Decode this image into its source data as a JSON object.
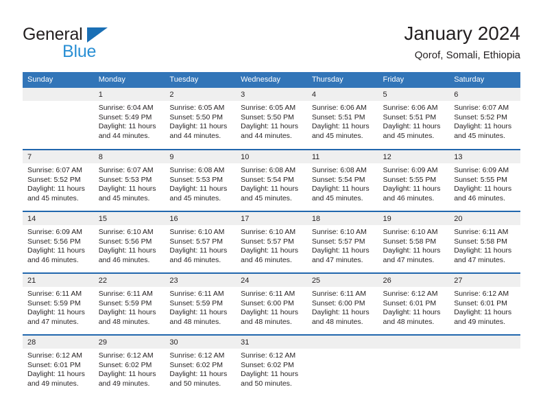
{
  "logo": {
    "primary_text": "General",
    "secondary_text": "Blue",
    "primary_color": "#231f20",
    "secondary_color": "#2a8fd4",
    "triangle_color": "#1a6fb5",
    "icon": "general-blue-logo"
  },
  "header": {
    "title": "January 2024",
    "subtitle": "Qorof, Somali, Ethiopia"
  },
  "theme": {
    "header_bg": "#3275b8",
    "header_text": "#ffffff",
    "row_separator": "#2066ad",
    "daynum_bg": "#efefef",
    "body_text": "#231f20"
  },
  "calendar": {
    "columns": [
      "Sunday",
      "Monday",
      "Tuesday",
      "Wednesday",
      "Thursday",
      "Friday",
      "Saturday"
    ],
    "weeks": [
      [
        {
          "day": "",
          "sunrise": "",
          "sunset": "",
          "daylight_line1": "",
          "daylight_line2": ""
        },
        {
          "day": "1",
          "sunrise": "Sunrise: 6:04 AM",
          "sunset": "Sunset: 5:49 PM",
          "daylight_line1": "Daylight: 11 hours",
          "daylight_line2": "and 44 minutes."
        },
        {
          "day": "2",
          "sunrise": "Sunrise: 6:05 AM",
          "sunset": "Sunset: 5:50 PM",
          "daylight_line1": "Daylight: 11 hours",
          "daylight_line2": "and 44 minutes."
        },
        {
          "day": "3",
          "sunrise": "Sunrise: 6:05 AM",
          "sunset": "Sunset: 5:50 PM",
          "daylight_line1": "Daylight: 11 hours",
          "daylight_line2": "and 44 minutes."
        },
        {
          "day": "4",
          "sunrise": "Sunrise: 6:06 AM",
          "sunset": "Sunset: 5:51 PM",
          "daylight_line1": "Daylight: 11 hours",
          "daylight_line2": "and 45 minutes."
        },
        {
          "day": "5",
          "sunrise": "Sunrise: 6:06 AM",
          "sunset": "Sunset: 5:51 PM",
          "daylight_line1": "Daylight: 11 hours",
          "daylight_line2": "and 45 minutes."
        },
        {
          "day": "6",
          "sunrise": "Sunrise: 6:07 AM",
          "sunset": "Sunset: 5:52 PM",
          "daylight_line1": "Daylight: 11 hours",
          "daylight_line2": "and 45 minutes."
        }
      ],
      [
        {
          "day": "7",
          "sunrise": "Sunrise: 6:07 AM",
          "sunset": "Sunset: 5:52 PM",
          "daylight_line1": "Daylight: 11 hours",
          "daylight_line2": "and 45 minutes."
        },
        {
          "day": "8",
          "sunrise": "Sunrise: 6:07 AM",
          "sunset": "Sunset: 5:53 PM",
          "daylight_line1": "Daylight: 11 hours",
          "daylight_line2": "and 45 minutes."
        },
        {
          "day": "9",
          "sunrise": "Sunrise: 6:08 AM",
          "sunset": "Sunset: 5:53 PM",
          "daylight_line1": "Daylight: 11 hours",
          "daylight_line2": "and 45 minutes."
        },
        {
          "day": "10",
          "sunrise": "Sunrise: 6:08 AM",
          "sunset": "Sunset: 5:54 PM",
          "daylight_line1": "Daylight: 11 hours",
          "daylight_line2": "and 45 minutes."
        },
        {
          "day": "11",
          "sunrise": "Sunrise: 6:08 AM",
          "sunset": "Sunset: 5:54 PM",
          "daylight_line1": "Daylight: 11 hours",
          "daylight_line2": "and 45 minutes."
        },
        {
          "day": "12",
          "sunrise": "Sunrise: 6:09 AM",
          "sunset": "Sunset: 5:55 PM",
          "daylight_line1": "Daylight: 11 hours",
          "daylight_line2": "and 46 minutes."
        },
        {
          "day": "13",
          "sunrise": "Sunrise: 6:09 AM",
          "sunset": "Sunset: 5:55 PM",
          "daylight_line1": "Daylight: 11 hours",
          "daylight_line2": "and 46 minutes."
        }
      ],
      [
        {
          "day": "14",
          "sunrise": "Sunrise: 6:09 AM",
          "sunset": "Sunset: 5:56 PM",
          "daylight_line1": "Daylight: 11 hours",
          "daylight_line2": "and 46 minutes."
        },
        {
          "day": "15",
          "sunrise": "Sunrise: 6:10 AM",
          "sunset": "Sunset: 5:56 PM",
          "daylight_line1": "Daylight: 11 hours",
          "daylight_line2": "and 46 minutes."
        },
        {
          "day": "16",
          "sunrise": "Sunrise: 6:10 AM",
          "sunset": "Sunset: 5:57 PM",
          "daylight_line1": "Daylight: 11 hours",
          "daylight_line2": "and 46 minutes."
        },
        {
          "day": "17",
          "sunrise": "Sunrise: 6:10 AM",
          "sunset": "Sunset: 5:57 PM",
          "daylight_line1": "Daylight: 11 hours",
          "daylight_line2": "and 46 minutes."
        },
        {
          "day": "18",
          "sunrise": "Sunrise: 6:10 AM",
          "sunset": "Sunset: 5:57 PM",
          "daylight_line1": "Daylight: 11 hours",
          "daylight_line2": "and 47 minutes."
        },
        {
          "day": "19",
          "sunrise": "Sunrise: 6:10 AM",
          "sunset": "Sunset: 5:58 PM",
          "daylight_line1": "Daylight: 11 hours",
          "daylight_line2": "and 47 minutes."
        },
        {
          "day": "20",
          "sunrise": "Sunrise: 6:11 AM",
          "sunset": "Sunset: 5:58 PM",
          "daylight_line1": "Daylight: 11 hours",
          "daylight_line2": "and 47 minutes."
        }
      ],
      [
        {
          "day": "21",
          "sunrise": "Sunrise: 6:11 AM",
          "sunset": "Sunset: 5:59 PM",
          "daylight_line1": "Daylight: 11 hours",
          "daylight_line2": "and 47 minutes."
        },
        {
          "day": "22",
          "sunrise": "Sunrise: 6:11 AM",
          "sunset": "Sunset: 5:59 PM",
          "daylight_line1": "Daylight: 11 hours",
          "daylight_line2": "and 48 minutes."
        },
        {
          "day": "23",
          "sunrise": "Sunrise: 6:11 AM",
          "sunset": "Sunset: 5:59 PM",
          "daylight_line1": "Daylight: 11 hours",
          "daylight_line2": "and 48 minutes."
        },
        {
          "day": "24",
          "sunrise": "Sunrise: 6:11 AM",
          "sunset": "Sunset: 6:00 PM",
          "daylight_line1": "Daylight: 11 hours",
          "daylight_line2": "and 48 minutes."
        },
        {
          "day": "25",
          "sunrise": "Sunrise: 6:11 AM",
          "sunset": "Sunset: 6:00 PM",
          "daylight_line1": "Daylight: 11 hours",
          "daylight_line2": "and 48 minutes."
        },
        {
          "day": "26",
          "sunrise": "Sunrise: 6:12 AM",
          "sunset": "Sunset: 6:01 PM",
          "daylight_line1": "Daylight: 11 hours",
          "daylight_line2": "and 48 minutes."
        },
        {
          "day": "27",
          "sunrise": "Sunrise: 6:12 AM",
          "sunset": "Sunset: 6:01 PM",
          "daylight_line1": "Daylight: 11 hours",
          "daylight_line2": "and 49 minutes."
        }
      ],
      [
        {
          "day": "28",
          "sunrise": "Sunrise: 6:12 AM",
          "sunset": "Sunset: 6:01 PM",
          "daylight_line1": "Daylight: 11 hours",
          "daylight_line2": "and 49 minutes."
        },
        {
          "day": "29",
          "sunrise": "Sunrise: 6:12 AM",
          "sunset": "Sunset: 6:02 PM",
          "daylight_line1": "Daylight: 11 hours",
          "daylight_line2": "and 49 minutes."
        },
        {
          "day": "30",
          "sunrise": "Sunrise: 6:12 AM",
          "sunset": "Sunset: 6:02 PM",
          "daylight_line1": "Daylight: 11 hours",
          "daylight_line2": "and 50 minutes."
        },
        {
          "day": "31",
          "sunrise": "Sunrise: 6:12 AM",
          "sunset": "Sunset: 6:02 PM",
          "daylight_line1": "Daylight: 11 hours",
          "daylight_line2": "and 50 minutes."
        },
        {
          "day": "",
          "sunrise": "",
          "sunset": "",
          "daylight_line1": "",
          "daylight_line2": ""
        },
        {
          "day": "",
          "sunrise": "",
          "sunset": "",
          "daylight_line1": "",
          "daylight_line2": ""
        },
        {
          "day": "",
          "sunrise": "",
          "sunset": "",
          "daylight_line1": "",
          "daylight_line2": ""
        }
      ]
    ]
  }
}
